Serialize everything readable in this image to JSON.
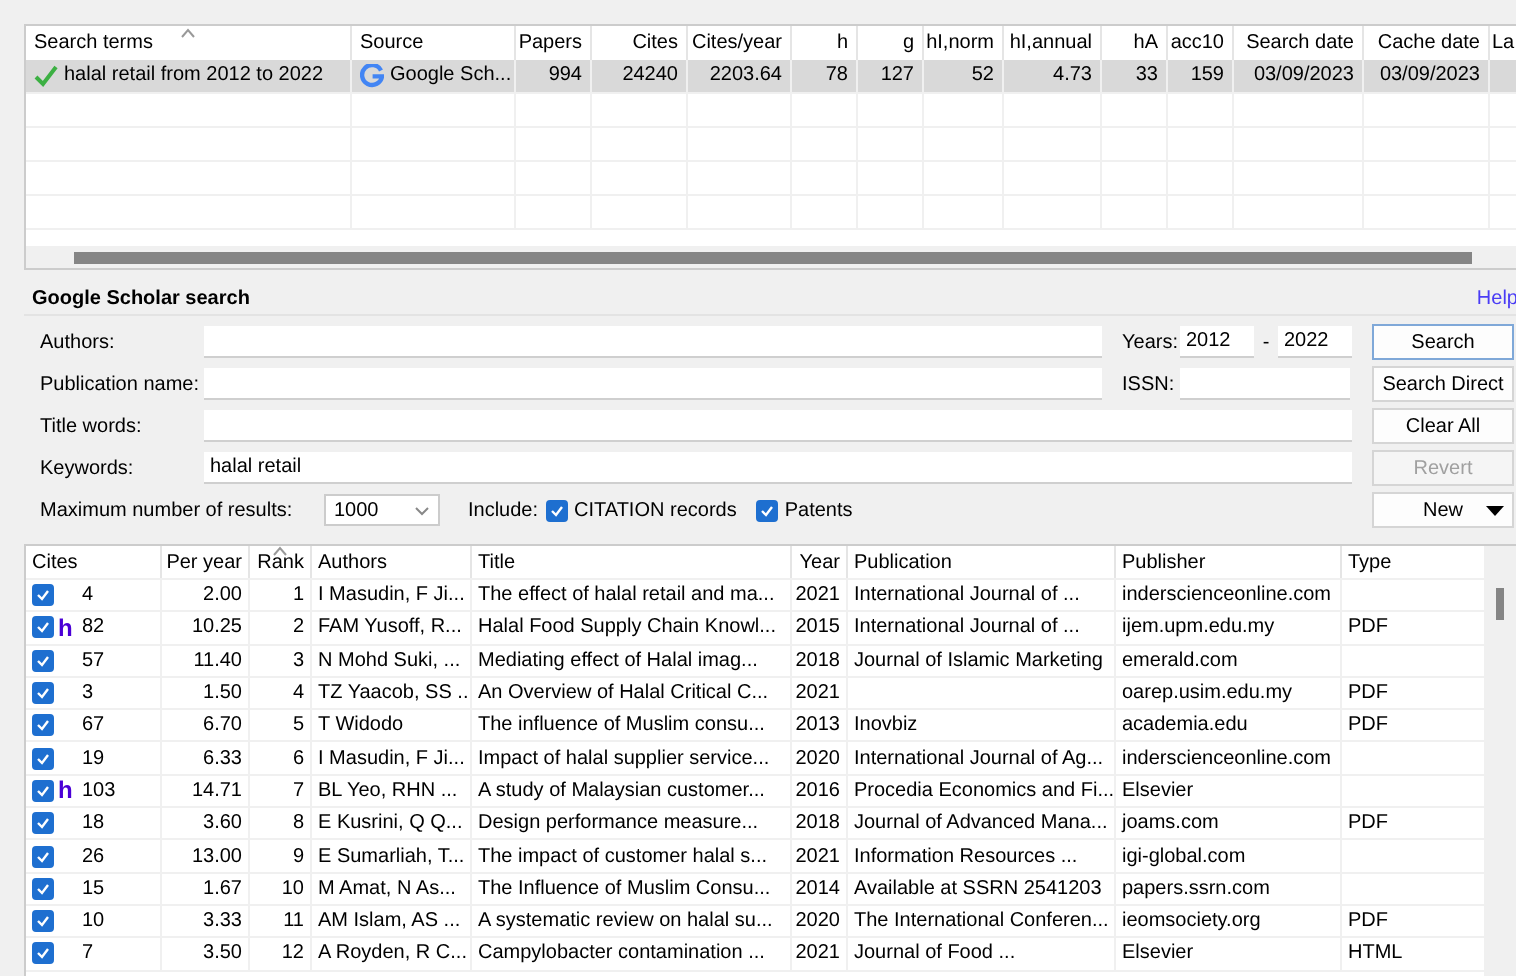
{
  "results_table": {
    "columns": [
      {
        "label": "Search terms",
        "sorted": true
      },
      {
        "label": "Source",
        "sorted": false
      },
      {
        "label": "Papers",
        "sorted": false
      },
      {
        "label": "Cites",
        "sorted": false
      },
      {
        "label": "Cites/year",
        "sorted": false
      },
      {
        "label": "h",
        "sorted": false
      },
      {
        "label": "g",
        "sorted": false
      },
      {
        "label": "hI,norm",
        "sorted": false
      },
      {
        "label": "hI,annual",
        "sorted": false
      },
      {
        "label": "hA",
        "sorted": false
      },
      {
        "label": "acc10",
        "sorted": false
      },
      {
        "label": "Search date",
        "sorted": false
      },
      {
        "label": "Cache date",
        "sorted": false
      },
      {
        "label": "La",
        "sorted": false
      }
    ],
    "rows": [
      {
        "selected": true,
        "cells": [
          "halal retail from 2012 to 2022",
          "Google Sch...",
          "994",
          "24240",
          "2203.64",
          "78",
          "127",
          "52",
          "4.73",
          "33",
          "159",
          "03/09/2023",
          "03/09/2023"
        ]
      }
    ]
  },
  "search_panel": {
    "title": "Google Scholar search",
    "help_link": "Help",
    "authors": {
      "label": "Authors:"
    },
    "publication_name": {
      "label": "Publication name:"
    },
    "title_words": {
      "label": "Title words:"
    },
    "keywords": {
      "label": "Keywords:",
      "value": "halal retail"
    },
    "years": {
      "label": "Years:",
      "from": "2012",
      "separator": "-",
      "to": "2022"
    },
    "issn": {
      "label": "ISSN:"
    },
    "max_results": {
      "label": "Maximum number of results:",
      "value": "1000"
    },
    "include": {
      "label": "Include:",
      "options": [
        {
          "label": "CITATION records",
          "checked": true
        },
        {
          "label": "Patents",
          "checked": true
        }
      ]
    },
    "buttons": [
      {
        "label": "Search",
        "kind": "plain",
        "disabled": false,
        "default": true
      },
      {
        "label": "Search Direct",
        "kind": "plain",
        "disabled": false,
        "default": false
      },
      {
        "label": "Clear All",
        "kind": "plain",
        "disabled": false,
        "default": false
      },
      {
        "label": "Revert",
        "kind": "plain",
        "disabled": true,
        "default": false
      },
      {
        "label": "New",
        "kind": "dropdown",
        "disabled": false,
        "default": false
      }
    ]
  },
  "papers_table": {
    "columns": [
      {
        "label": "Cites",
        "sorted": false
      },
      {
        "label": "Per year",
        "sorted": false
      },
      {
        "label": "Rank",
        "sorted": true
      },
      {
        "label": "Authors",
        "sorted": false
      },
      {
        "label": "Title",
        "sorted": false
      },
      {
        "label": "Year",
        "sorted": false
      },
      {
        "label": "Publication",
        "sorted": false
      },
      {
        "label": "Publisher",
        "sorted": false
      },
      {
        "label": "Type",
        "sorted": false
      }
    ],
    "rows": [
      {
        "checked": true,
        "cites": "4",
        "per_year": "2.00",
        "rank": "1",
        "authors": "I Masudin, F Ji...",
        "title": "The effect of halal retail and ma...",
        "year": "2021",
        "publication": "International Journal of ...",
        "publisher": "inderscienceonline.com"
      },
      {
        "checked": true,
        "marker": "h",
        "cites": "82",
        "per_year": "10.25",
        "rank": "2",
        "authors": "FAM Yusoff, R...",
        "title": "Halal Food Supply Chain Knowl...",
        "year": "2015",
        "publication": "International Journal of ...",
        "publisher": "ijem.upm.edu.my",
        "type": "PDF"
      },
      {
        "checked": true,
        "cites": "57",
        "per_year": "11.40",
        "rank": "3",
        "authors": "N Mohd Suki, ...",
        "title": "Mediating effect of Halal imag...",
        "year": "2018",
        "publication": "Journal of Islamic Marketing",
        "publisher": "emerald.com"
      },
      {
        "checked": true,
        "cites": "3",
        "per_year": "1.50",
        "rank": "4",
        "authors": "TZ Yaacob, SS ...",
        "title": "An Overview of Halal Critical C...",
        "year": "2021",
        "publisher": "oarep.usim.edu.my",
        "type": "PDF"
      },
      {
        "checked": true,
        "cites": "67",
        "per_year": "6.70",
        "rank": "5",
        "authors": "T Widodo",
        "title": "The influence of Muslim consu...",
        "year": "2013",
        "publication": "Inovbiz",
        "publisher": "academia.edu",
        "type": "PDF"
      },
      {
        "checked": true,
        "cites": "19",
        "per_year": "6.33",
        "rank": "6",
        "authors": "I Masudin, F Ji...",
        "title": "Impact of halal supplier service...",
        "year": "2020",
        "publication": "International Journal of Ag...",
        "publisher": "inderscienceonline.com"
      },
      {
        "checked": true,
        "marker": "h",
        "cites": "103",
        "per_year": "14.71",
        "rank": "7",
        "authors": "BL Yeo, RHN ...",
        "title": "A study of Malaysian customer...",
        "year": "2016",
        "publication": "Procedia Economics and Fi...",
        "publisher": "Elsevier"
      },
      {
        "checked": true,
        "cites": "18",
        "per_year": "3.60",
        "rank": "8",
        "authors": "E Kusrini, Q Q...",
        "title": "Design performance measure...",
        "year": "2018",
        "publication": "Journal of Advanced Mana...",
        "publisher": "joams.com",
        "type": "PDF"
      },
      {
        "checked": true,
        "cites": "26",
        "per_year": "13.00",
        "rank": "9",
        "authors": "E Sumarliah, T...",
        "title": "The impact of customer halal s...",
        "year": "2021",
        "publication": "Information Resources ...",
        "publisher": "igi-global.com"
      },
      {
        "checked": true,
        "cites": "15",
        "per_year": "1.67",
        "rank": "10",
        "authors": "M Amat, N As...",
        "title": "The Influence of Muslim Consu...",
        "year": "2014",
        "publication": "Available at SSRN 2541203",
        "publisher": "papers.ssrn.com"
      },
      {
        "checked": true,
        "cites": "10",
        "per_year": "3.33",
        "rank": "11",
        "authors": "AM Islam, AS ...",
        "title": "A systematic review on halal su...",
        "year": "2020",
        "publication": "The International Conferen...",
        "publisher": "ieomsociety.org",
        "type": "PDF"
      },
      {
        "checked": true,
        "cites": "7",
        "per_year": "3.50",
        "rank": "12",
        "authors": "A Royden, R C...",
        "title": "Campylobacter contamination ...",
        "year": "2021",
        "publication": "Journal of Food ...",
        "publisher": "Elsevier",
        "type": "HTML"
      }
    ]
  }
}
